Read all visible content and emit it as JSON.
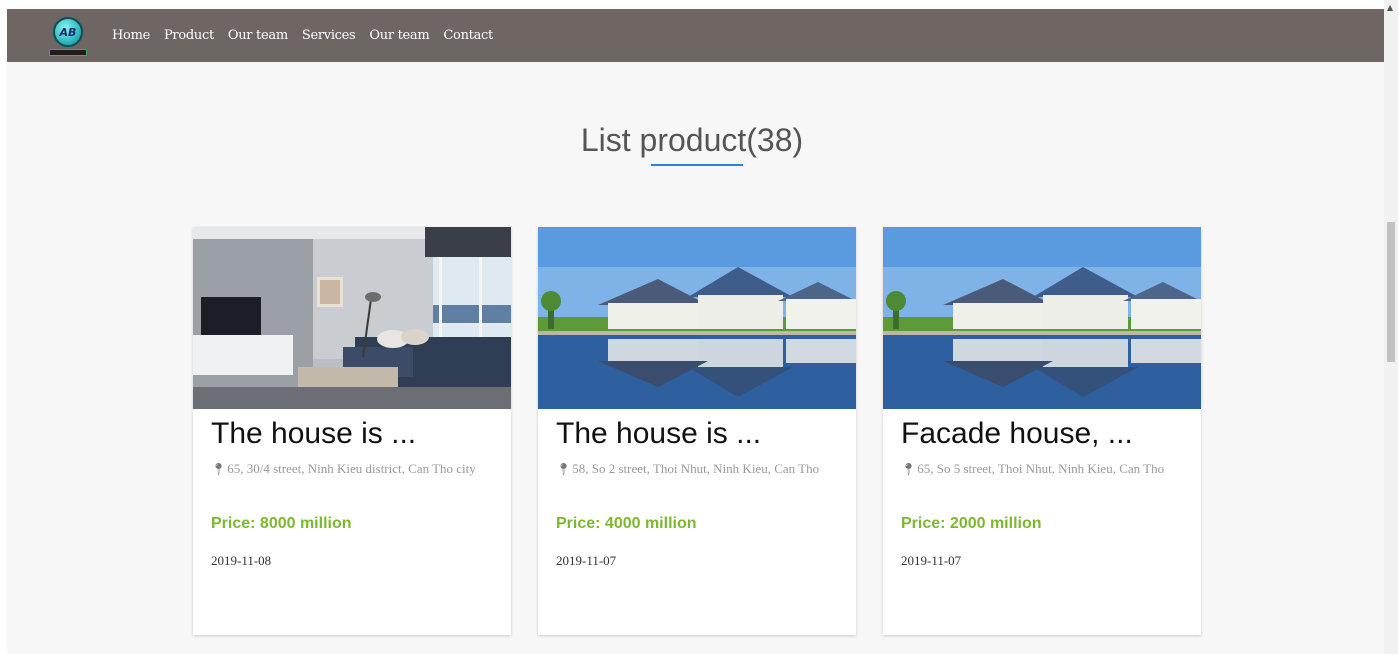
{
  "nav": {
    "logo_text": "AB",
    "links": [
      "Home",
      "Product",
      "Our team",
      "Services",
      "Our team",
      "Contact"
    ]
  },
  "section": {
    "title": "List product(38)"
  },
  "products": [
    {
      "name": "The house is ...",
      "address": "65, 30/4 street, Ninh Kieu district, Can Tho city",
      "price": "Price: 8000 million",
      "date": "2019-11-08",
      "image": "living-room-photo"
    },
    {
      "name": "The house is ...",
      "address": "58, So 2 street, Thoi Nhut, Ninh Kieu, Can Tho",
      "price": "Price: 4000 million",
      "date": "2019-11-07",
      "image": "waterfront-houses-photo"
    },
    {
      "name": "Facade house, ...",
      "address": "65, So 5 street, Thoi Nhut, Ninh Kieu, Can Tho",
      "price": "Price: 2000 million",
      "date": "2019-11-07",
      "image": "waterfront-houses-photo"
    }
  ],
  "colors": {
    "navbar": "#6d6663",
    "price": "#7cb82f",
    "underline": "#1e88e5"
  }
}
